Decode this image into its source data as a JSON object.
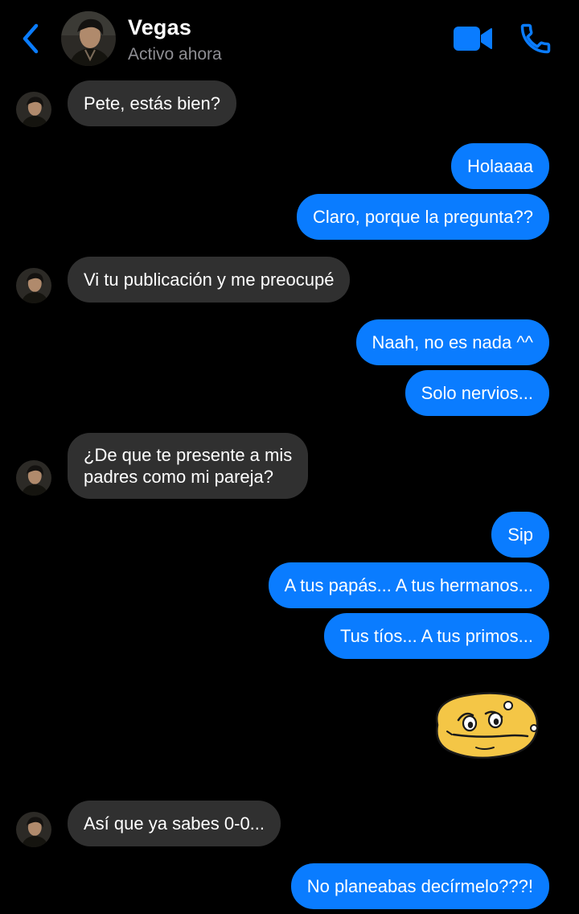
{
  "header": {
    "name": "Vegas",
    "status": "Activo ahora",
    "back_icon": "chevron-left-icon",
    "video_icon": "video-camera-icon",
    "call_icon": "phone-icon",
    "accent_color": "#0a7cff"
  },
  "messages": [
    {
      "from": "them",
      "text": "Pete, estás bien?"
    },
    {
      "from": "me",
      "text": "Holaaaa"
    },
    {
      "from": "me",
      "text": "Claro, porque la pregunta??"
    },
    {
      "from": "them",
      "text": "Vi tu publicación y me preocupé"
    },
    {
      "from": "me",
      "text": "Naah, no es nada ^^"
    },
    {
      "from": "me",
      "text": "Solo nervios..."
    },
    {
      "from": "them",
      "lines": [
        "¿De que te presente a mis",
        "padres como mi pareja?"
      ]
    },
    {
      "from": "me",
      "text": "Sip"
    },
    {
      "from": "me",
      "text": "A tus papás... A tus hermanos..."
    },
    {
      "from": "me",
      "text": "Tus tíos... A tus primos..."
    },
    {
      "from": "me",
      "sticker": "worried-potato-sticker"
    },
    {
      "from": "them",
      "text": "Así que ya sabes 0-0..."
    },
    {
      "from": "me",
      "text": "No planeabas decírmelo???!"
    }
  ],
  "colors": {
    "incoming_bubble": "#303030",
    "outgoing_bubble": "#0a7cff",
    "background": "#000000",
    "status_text": "#8e8e93",
    "sticker_fill": "#f4c646"
  }
}
